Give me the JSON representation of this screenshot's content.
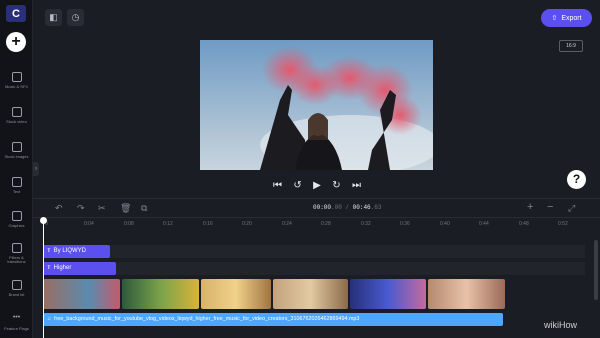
{
  "sidebar": {
    "logo": "C",
    "add": "+",
    "items": [
      {
        "label": "Music & SFX",
        "icon": "music-icon"
      },
      {
        "label": "Stock video",
        "icon": "film-icon"
      },
      {
        "label": "Stock images",
        "icon": "image-icon"
      },
      {
        "label": "Text",
        "icon": "text-icon"
      },
      {
        "label": "Graphics",
        "icon": "shapes-icon"
      },
      {
        "label": "Filters & transitions",
        "icon": "filters-icon"
      },
      {
        "label": "Brand kit",
        "icon": "brand-kit-icon"
      },
      {
        "label": "Feature Flags",
        "icon": "more-icon"
      }
    ],
    "collapse": "›"
  },
  "toolbar": {
    "export_label": "Export",
    "aspect_ratio": "16:9"
  },
  "player": {
    "controls": [
      "⏮",
      "↺",
      "▶",
      "↻",
      "⏭"
    ],
    "help": "?"
  },
  "timeline": {
    "timecode_current": "00:00",
    "timecode_current_frames": ".00",
    "timecode_sep": " / ",
    "timecode_total": "00:46",
    "timecode_total_frames": ".63",
    "ruler": [
      "0",
      "0:04",
      "0:08",
      "0:12",
      "0:16",
      "0:20",
      "0:24",
      "0:28",
      "0:32",
      "0:36",
      "0:40",
      "0:44",
      "0:48",
      "0:52"
    ],
    "text_clips": [
      {
        "label": "By LIQWYD",
        "icon": "T"
      },
      {
        "label": "Higher",
        "icon": "T"
      }
    ],
    "audio_icon": "♫",
    "audio_label": "free_background_music_for_youtube_vlog_videos_liqwyd_higher_free_music_for_video_creators_3106762026462869494.mp3",
    "video_clip_colors": [
      "#7a5a52",
      "#3f6a4b",
      "#d3a35c",
      "#b49a78",
      "#c7b28b",
      "#3a3f8a",
      "#c29c86"
    ]
  },
  "watermark": "wikiHow"
}
